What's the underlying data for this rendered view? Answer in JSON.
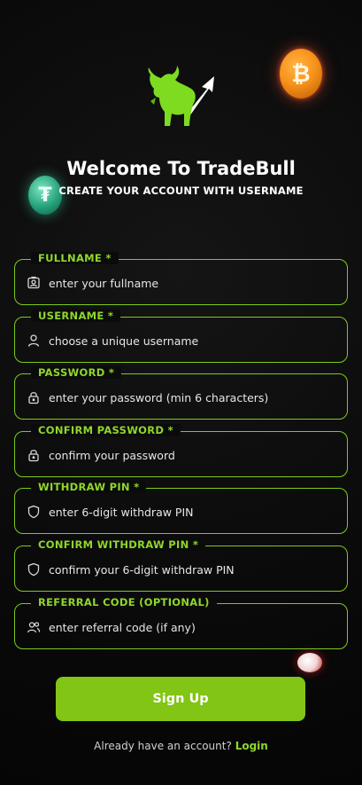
{
  "header": {
    "title": "Welcome To TradeBull",
    "subtitle": "CREATE YOUR ACCOUNT WITH USERNAME"
  },
  "fields": [
    {
      "label": "FULLNAME *",
      "placeholder": "enter your fullname",
      "icon": "id-card-icon"
    },
    {
      "label": "USERNAME *",
      "placeholder": "choose a unique username",
      "icon": "user-icon"
    },
    {
      "label": "PASSWORD *",
      "placeholder": "enter your password (min 6 characters)",
      "icon": "lock-icon"
    },
    {
      "label": "CONFIRM PASSWORD *",
      "placeholder": "confirm your password",
      "icon": "lock-icon"
    },
    {
      "label": "WITHDRAW PIN *",
      "placeholder": "enter 6-digit withdraw PIN",
      "icon": "shield-icon"
    },
    {
      "label": "CONFIRM WITHDRAW PIN *",
      "placeholder": "confirm your 6-digit withdraw PIN",
      "icon": "shield-icon"
    },
    {
      "label": "REFERRAL CODE (OPTIONAL)",
      "placeholder": "enter referral code (if any)",
      "icon": "users-icon"
    }
  ],
  "signup_label": "Sign Up",
  "footer": {
    "prompt": "Already have an account?",
    "login_label": "Login"
  },
  "colors": {
    "accent": "#82c514",
    "label": "#8fd72a",
    "border": "#7ccb1c",
    "background": "#0b0b0b"
  }
}
